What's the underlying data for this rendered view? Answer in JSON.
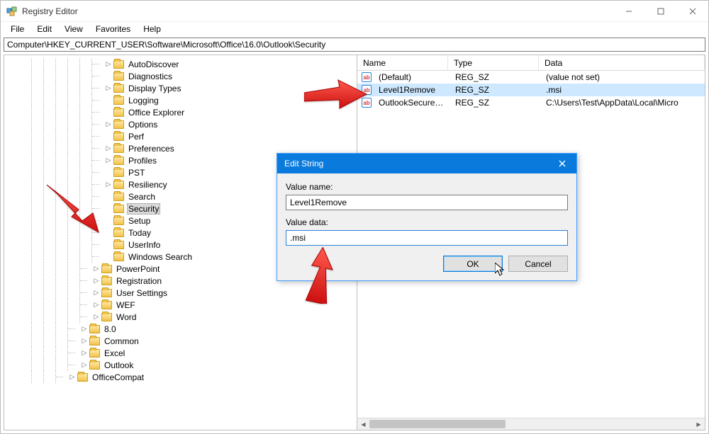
{
  "title": "Registry Editor",
  "menubar": [
    "File",
    "Edit",
    "View",
    "Favorites",
    "Help"
  ],
  "address": "Computer\\HKEY_CURRENT_USER\\Software\\Microsoft\\Office\\16.0\\Outlook\\Security",
  "tree": {
    "items": [
      {
        "depth": 3,
        "label": "AutoDiscover",
        "expander": ">",
        "selected": false
      },
      {
        "depth": 3,
        "label": "Diagnostics",
        "expander": "",
        "selected": false
      },
      {
        "depth": 3,
        "label": "Display Types",
        "expander": ">",
        "selected": false
      },
      {
        "depth": 3,
        "label": "Logging",
        "expander": "",
        "selected": false
      },
      {
        "depth": 3,
        "label": "Office Explorer",
        "expander": "",
        "selected": false
      },
      {
        "depth": 3,
        "label": "Options",
        "expander": ">",
        "selected": false
      },
      {
        "depth": 3,
        "label": "Perf",
        "expander": "",
        "selected": false
      },
      {
        "depth": 3,
        "label": "Preferences",
        "expander": ">",
        "selected": false
      },
      {
        "depth": 3,
        "label": "Profiles",
        "expander": ">",
        "selected": false
      },
      {
        "depth": 3,
        "label": "PST",
        "expander": "",
        "selected": false
      },
      {
        "depth": 3,
        "label": "Resiliency",
        "expander": ">",
        "selected": false
      },
      {
        "depth": 3,
        "label": "Search",
        "expander": "",
        "selected": false
      },
      {
        "depth": 3,
        "label": "Security",
        "expander": "",
        "selected": true
      },
      {
        "depth": 3,
        "label": "Setup",
        "expander": "",
        "selected": false
      },
      {
        "depth": 3,
        "label": "Today",
        "expander": "",
        "selected": false
      },
      {
        "depth": 3,
        "label": "UserInfo",
        "expander": "",
        "selected": false
      },
      {
        "depth": 3,
        "label": "Windows Search",
        "expander": "",
        "selected": false
      },
      {
        "depth": 2,
        "label": "PowerPoint",
        "expander": ">",
        "selected": false
      },
      {
        "depth": 2,
        "label": "Registration",
        "expander": ">",
        "selected": false
      },
      {
        "depth": 2,
        "label": "User Settings",
        "expander": ">",
        "selected": false
      },
      {
        "depth": 2,
        "label": "WEF",
        "expander": ">",
        "selected": false
      },
      {
        "depth": 2,
        "label": "Word",
        "expander": ">",
        "selected": false
      },
      {
        "depth": 1,
        "label": "8.0",
        "expander": ">",
        "selected": false
      },
      {
        "depth": 1,
        "label": "Common",
        "expander": ">",
        "selected": false
      },
      {
        "depth": 1,
        "label": "Excel",
        "expander": ">",
        "selected": false
      },
      {
        "depth": 1,
        "label": "Outlook",
        "expander": ">",
        "selected": false
      },
      {
        "depth": 0,
        "label": "OfficeCompat",
        "expander": ">",
        "selected": false
      }
    ]
  },
  "list": {
    "headers": [
      "Name",
      "Type",
      "Data"
    ],
    "rows": [
      {
        "name": "(Default)",
        "type": "REG_SZ",
        "data": "(value not set)",
        "selected": false
      },
      {
        "name": "Level1Remove",
        "type": "REG_SZ",
        "data": ".msi",
        "selected": true
      },
      {
        "name": "OutlookSecureT…",
        "type": "REG_SZ",
        "data": "C:\\Users\\Test\\AppData\\Local\\Micro",
        "selected": false
      }
    ]
  },
  "dialog": {
    "title": "Edit String",
    "value_name_label": "Value name:",
    "value_name": "Level1Remove",
    "value_data_label": "Value data:",
    "value_data": ".msi",
    "ok": "OK",
    "cancel": "Cancel"
  }
}
